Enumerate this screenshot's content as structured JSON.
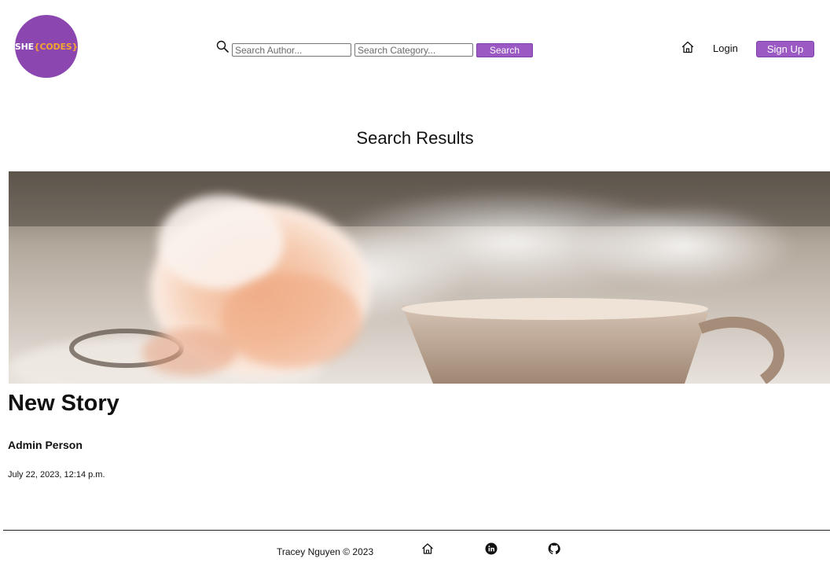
{
  "header": {
    "logo": {
      "part1": "SHE",
      "part2": "{CODES}"
    },
    "search": {
      "author_placeholder": "Search Author...",
      "category_placeholder": "Search Category...",
      "button_label": "Search"
    },
    "nav": {
      "login_label": "Login",
      "signup_label": "Sign Up"
    }
  },
  "main": {
    "page_title": "Search Results",
    "story": {
      "title": "New Story",
      "author": "Admin Person",
      "date": "July 22, 2023, 12:14 p.m."
    }
  },
  "footer": {
    "copyright": "Tracey Nguyen  © 2023"
  },
  "icons": [
    "search-icon",
    "home-icon",
    "linkedin-icon",
    "github-icon"
  ],
  "colors": {
    "brand_purple": "#9b59c4",
    "logo_purple": "#8b46b0",
    "logo_orange": "#f3a530"
  }
}
